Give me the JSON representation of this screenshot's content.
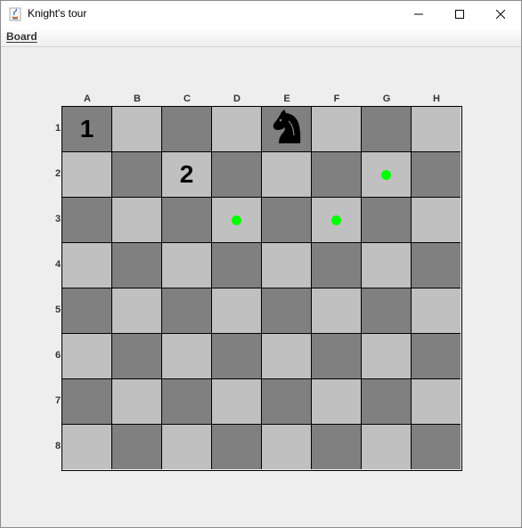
{
  "window": {
    "title": "Knight's tour"
  },
  "menubar": {
    "board_menu_label": "Board"
  },
  "board": {
    "columns": [
      "A",
      "B",
      "C",
      "D",
      "E",
      "F",
      "G",
      "H"
    ],
    "rows": [
      "1",
      "2",
      "3",
      "4",
      "5",
      "6",
      "7",
      "8"
    ],
    "dark_color": "#808080",
    "light_color": "#c0c0c0",
    "dot_color": "#00ff00",
    "visited": [
      {
        "square": "A1",
        "number": "1"
      },
      {
        "square": "C2",
        "number": "2"
      }
    ],
    "knight_square": "E1",
    "possible_moves": [
      "G2",
      "D3",
      "F3"
    ]
  }
}
